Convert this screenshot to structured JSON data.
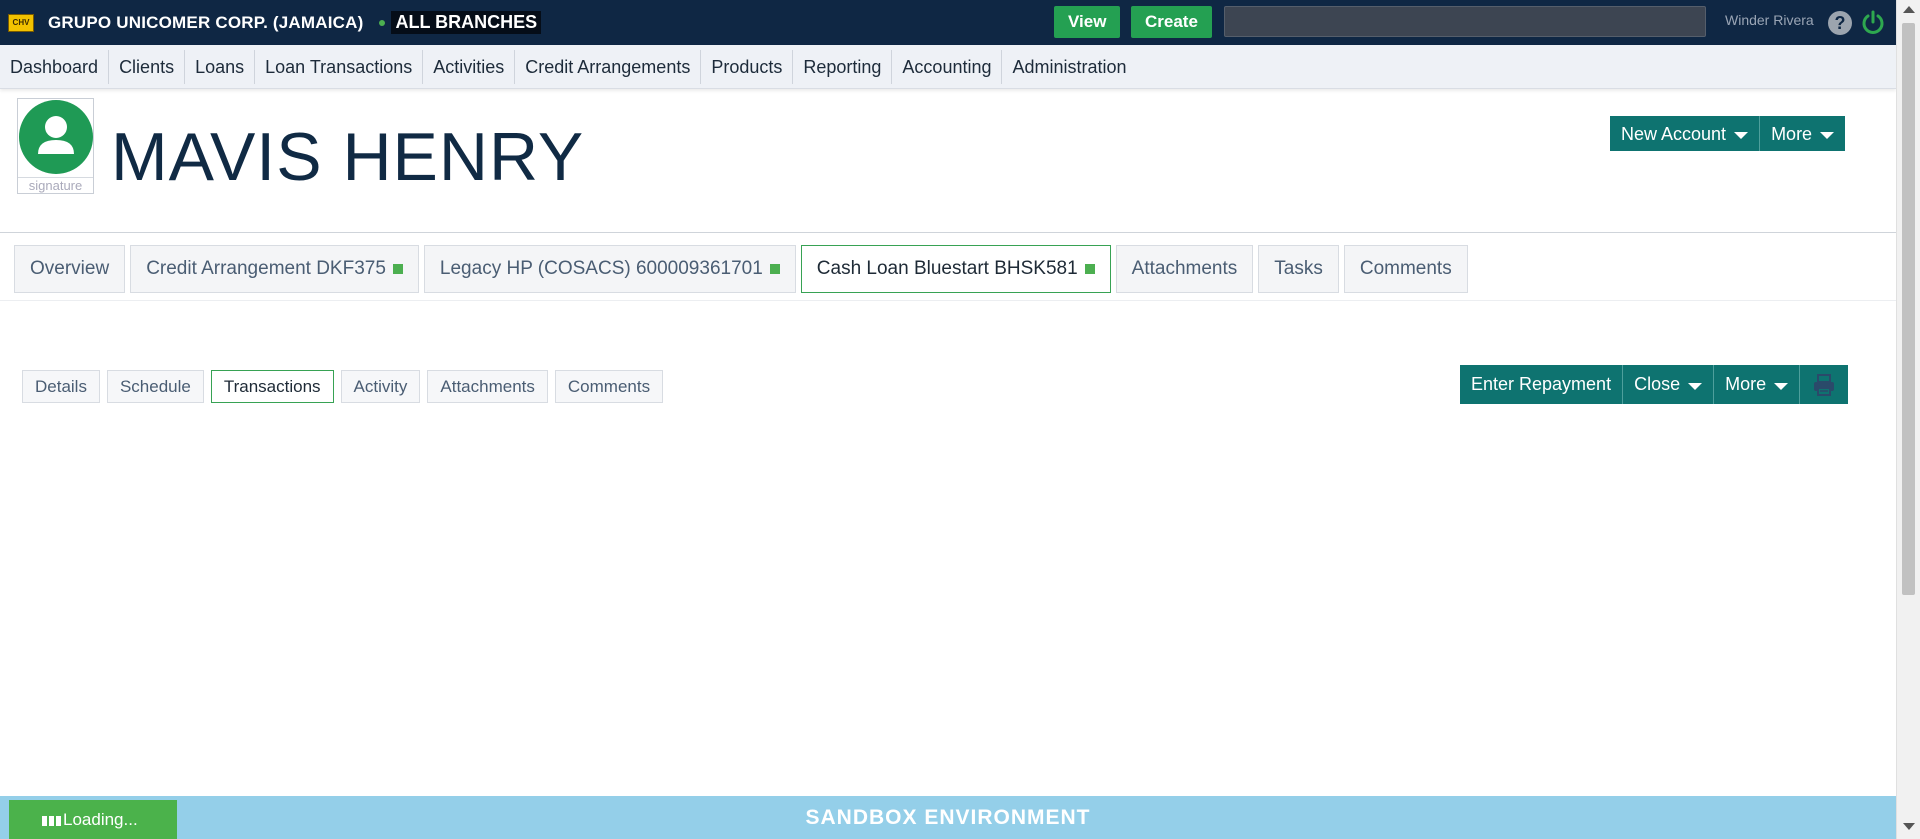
{
  "topbar": {
    "logo_text": "CHV",
    "org_name": "GRUPO UNICOMER CORP. (JAMAICA)",
    "branch": "ALL BRANCHES",
    "view_label": "View",
    "create_label": "Create",
    "search_value": "",
    "user_name": "Winder Rivera",
    "help_glyph": "?",
    "brand_color": "#0f2744"
  },
  "nav": {
    "items": [
      "Dashboard",
      "Clients",
      "Loans",
      "Loan Transactions",
      "Activities",
      "Credit Arrangements",
      "Products",
      "Reporting",
      "Accounting",
      "Administration"
    ]
  },
  "client": {
    "name": "MAVIS HENRY",
    "avatar_caption": "signature",
    "new_account_label": "New Account",
    "more_label": "More"
  },
  "account_tabs": [
    {
      "label": "Overview",
      "status": false
    },
    {
      "label": "Credit Arrangement DKF375",
      "status": true
    },
    {
      "label": "Legacy HP (COSACS) 600009361701",
      "status": true
    },
    {
      "label": "Cash Loan Bluestart BHSK581",
      "status": true,
      "active": true
    },
    {
      "label": "Attachments",
      "status": false
    },
    {
      "label": "Tasks",
      "status": false
    },
    {
      "label": "Comments",
      "status": false
    }
  ],
  "sub_tabs": [
    "Details",
    "Schedule",
    "Transactions",
    "Activity",
    "Attachments",
    "Comments"
  ],
  "active_sub_tab": "Transactions",
  "loan_actions": {
    "enter_repayment": "Enter Repayment",
    "close": "Close",
    "more": "More",
    "print_icon": "printer-icon"
  },
  "footer": {
    "environment": "SANDBOX ENVIRONMENT",
    "loading": "Loading..."
  },
  "colors": {
    "accent_teal": "#0e7370",
    "green": "#24a052",
    "sandbox": "#94cfe9"
  }
}
